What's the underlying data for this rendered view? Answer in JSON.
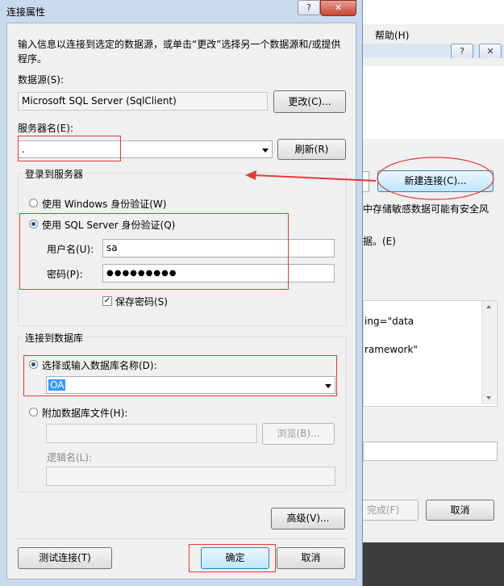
{
  "background_window": {
    "menu_help": "帮助(H)",
    "help_btn": "?",
    "close_btn": "✕",
    "new_connection_button": "新建连接(C)...",
    "warning_text": "中存储敏感数据可能有安全风",
    "option_text": "据。(E)",
    "conn_text_1": "ing=\"data",
    "conn_text_2": "ramework\"",
    "finish_button": "完成(F)",
    "cancel_button": "取消"
  },
  "dialog": {
    "title": "连接属性",
    "help_btn": "?",
    "close_btn": "✕",
    "intro": "输入信息以连接到选定的数据源，或单击“更改”选择另一个数据源和/或提供程序。",
    "datasource_label": "数据源(S):",
    "datasource_value": "Microsoft SQL Server (SqlClient)",
    "change_button": "更改(C)...",
    "server_label": "服务器名(E):",
    "server_value": ".",
    "refresh_button": "刷新(R)",
    "login_group_title": "登录到服务器",
    "windows_auth_label": "使用 Windows 身份验证(W)",
    "sql_auth_label": "使用 SQL Server 身份验证(Q)",
    "username_label": "用户名(U):",
    "username_value": "sa",
    "password_label": "密码(P):",
    "password_value": "●●●●●●●●●",
    "save_password_label": "保存密码(S)",
    "db_group_title": "连接到数据库",
    "select_db_label": "选择或输入数据库名称(D):",
    "db_value": "OA",
    "attach_file_label": "附加数据库文件(H):",
    "browse_button": "浏览(B)...",
    "logical_name_label": "逻辑名(L):",
    "advanced_button": "高级(V)...",
    "test_button": "测试连接(T)",
    "ok_button": "确定",
    "cancel_button": "取消"
  },
  "colors": {
    "annotation_red": "#e33a3a",
    "selection_blue": "#3399ff",
    "dialog_bg": "#f0f0f0",
    "titlebar": "#c9d9ee"
  }
}
